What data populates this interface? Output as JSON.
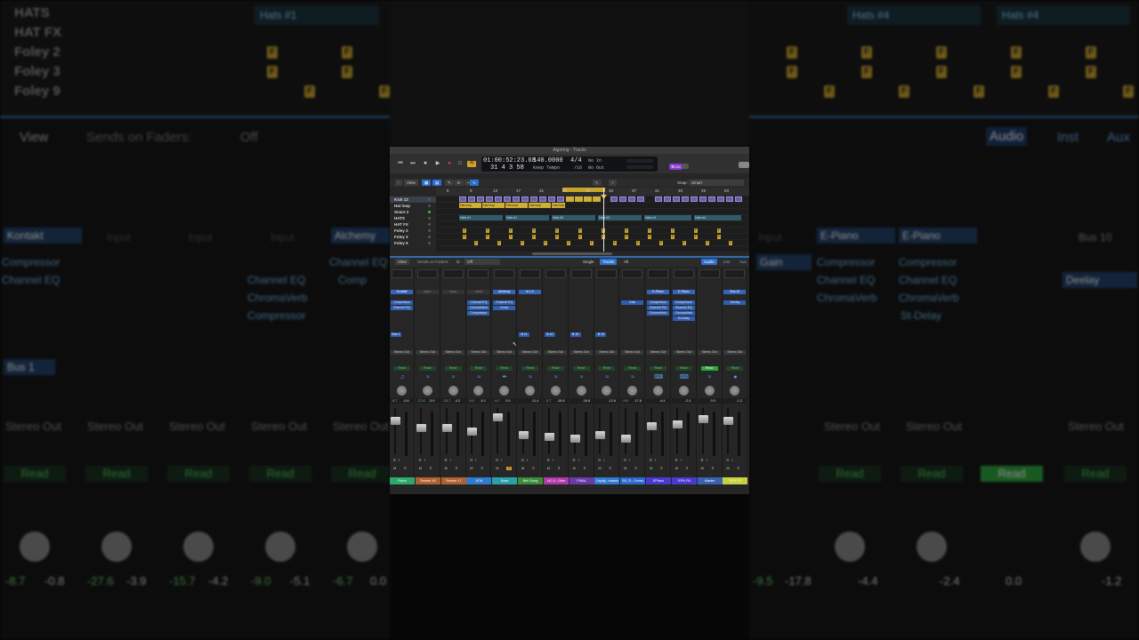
{
  "window_title": "Algoring - Tracks",
  "transport": {
    "position": "01:00:52:23.68",
    "bars": "31  4  3    58",
    "tempo": "140.0000",
    "tempo_mode": "Keep Tempo",
    "sig_top": "4/4",
    "sig_bottom": "/16",
    "in_label": "No In",
    "out_label": "No Out",
    "badge_left": "⌘134"
  },
  "arrange_toolbar": {
    "view": "View",
    "snap_label": "Snap:",
    "snap_value": "Smart"
  },
  "ruler": [
    "5",
    "9",
    "13",
    "17",
    "21",
    "25",
    "29",
    "33",
    "37",
    "41",
    "45",
    "49",
    "53"
  ],
  "tracks": [
    "Kick 12",
    "Hat loop",
    "Snare 2",
    "HATS",
    "HAT FX",
    "Foley 2",
    "Foley 3",
    "Foley 9"
  ],
  "regions": {
    "hat_loop": "Hat loop",
    "hats": [
      "Hats #1",
      "Hats #3",
      "Hats #4",
      "Hats #4"
    ]
  },
  "mixer_toolbar": {
    "view": "View",
    "sends_on_faders": "Sends on Faders:",
    "off": "Off",
    "single": "Single",
    "tracks": "Tracks",
    "all": "All",
    "audio": "Audio",
    "inst": "Inst",
    "aux": "Aux"
  },
  "common": {
    "stereo_out": "Stereo Out",
    "read": "Read",
    "mute": "M",
    "solo": "S",
    "rec": "R",
    "input_mon": "I"
  },
  "strips": [
    {
      "name": "Piano",
      "color": "#2ea86a",
      "input": "Kontakt",
      "plugins": [
        "Compressor",
        "Channel EQ"
      ],
      "send": "Bus 1",
      "va": "-8.7",
      "vb": "-0.8",
      "icon": "♫"
    },
    {
      "name": "Texture 16",
      "color": "#b0622e",
      "input": "Input",
      "plugins": [],
      "send": "",
      "va": "-27.6",
      "vb": "-3.9",
      "icon": "≈"
    },
    {
      "name": "Texture 17",
      "color": "#b0622e",
      "input": "Input",
      "plugins": [],
      "send": "",
      "va": "-15.7",
      "vb": "-4.2",
      "icon": "≈"
    },
    {
      "name": "ATM",
      "color": "#2f7bd0",
      "input": "Input",
      "plugins": [
        "Channel EQ",
        "ChromaVerb",
        "Compressor"
      ],
      "send": "",
      "va": "-9.0",
      "vb": "-5.1",
      "icon": "≈"
    },
    {
      "name": "Bass",
      "color": "#2aa0a8",
      "input": "Alchemy",
      "plugins": [
        "Channel EQ",
        "Comp"
      ],
      "send": "",
      "va": "-6.7",
      "vb": "0.0",
      "icon": "✒"
    },
    {
      "name": "Bell Gong",
      "color": "#3a8e3a",
      "input": "In 1-2",
      "plugins": [],
      "send": "B 11",
      "va": "",
      "vb": "-11.4",
      "icon": "≈"
    },
    {
      "name": "140 V...G#m",
      "color": "#b03aa8",
      "input": "",
      "plugins": [],
      "send": "B 10",
      "va": "-3.7",
      "vb": "-15.8",
      "icon": "≈"
    },
    {
      "name": "FINAL",
      "color": "#6a3aa8",
      "input": "",
      "plugins": [],
      "send": "B 10",
      "va": "",
      "vb": "-16.8",
      "icon": "≈"
    },
    {
      "name": "Daylig...makes",
      "color": "#2f7bd0",
      "input": "",
      "plugins": [],
      "send": "B 10",
      "va": "",
      "vb": "-12.6",
      "icon": "≈"
    },
    {
      "name": "SD_R...Ocean",
      "color": "#2a6ad0",
      "input": "",
      "plugins": [
        "Gain"
      ],
      "send": "",
      "va": "-9.5",
      "vb": "-17.8",
      "icon": "≈"
    },
    {
      "name": "EPiano",
      "color": "#4a3ad0",
      "input": "E-Piano",
      "plugins": [
        "Compressor",
        "Channel EQ",
        "ChromaVerb"
      ],
      "send": "",
      "va": "",
      "vb": "-4.4",
      "icon": "⌨"
    },
    {
      "name": "EPN Fill",
      "color": "#4a3ad0",
      "input": "E-Piano",
      "plugins": [
        "Compressor",
        "Channel EQ",
        "ChromaVerb",
        "St-Delay"
      ],
      "send": "",
      "va": "",
      "vb": "-2.4",
      "icon": "⌨"
    },
    {
      "name": "Master",
      "color": "#3a62b0",
      "input": "",
      "plugins": [],
      "send": "",
      "va": "",
      "vb": "0.0",
      "icon": "≈"
    },
    {
      "name": "VOX FX",
      "color": "#c8d040",
      "input": "Bus 10",
      "plugins": [
        "Deelay"
      ],
      "send": "",
      "va": "",
      "vb": "-1.2",
      "icon": "●"
    }
  ],
  "backdrop": {
    "tracks": [
      "HATS",
      "HAT FX",
      "Foley 2",
      "Foley 3",
      "Foley 9"
    ],
    "region_left": "Hats #1",
    "region_right": [
      "Hats #4",
      "Hats #4"
    ],
    "view": "View",
    "sends": "Sends on Faders:",
    "off": "Off",
    "tabs": [
      "Audio",
      "Inst",
      "Aux"
    ],
    "gain": "Gain",
    "left_strips": {
      "kontakt": "Kontakt",
      "compressor": "Compressor",
      "channel_eq": "Channel EQ",
      "input": "Input",
      "alchemy": "Alchemy",
      "chromaverb": "ChromaVerb",
      "comp": "Comp",
      "bus1": "Bus 1"
    },
    "right_strips": {
      "epiano": "E-Piano",
      "compressor": "Compressor",
      "channel_eq": "Channel EQ",
      "chromaverb": "ChromaVerb",
      "stdelay": "St-Delay",
      "bus10": "Bus 10",
      "deelay": "Deelay",
      "input": "Input"
    },
    "stereo_out": "Stereo Out",
    "read": "Read",
    "left_vals": [
      "-8.7",
      "-0.8",
      "-27.6",
      "-3.9",
      "-15.7",
      "-4.2",
      "-9.0",
      "-5.1",
      "-6.7",
      "0.0"
    ],
    "right_vals": [
      "-9.5",
      "-17.8",
      "-4.4",
      "-2.4",
      "0.0",
      "-1.2"
    ]
  }
}
